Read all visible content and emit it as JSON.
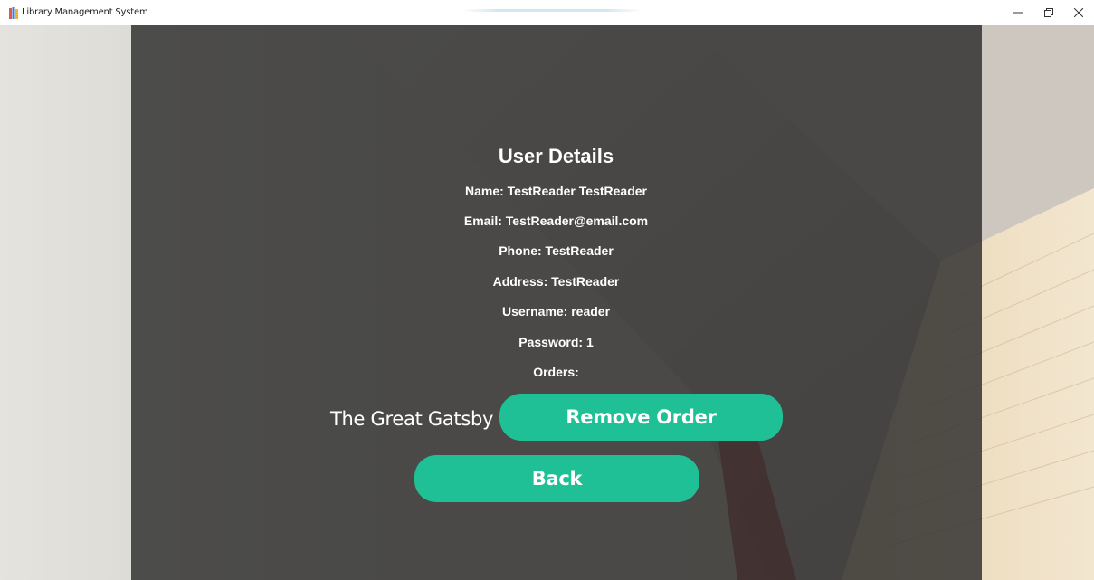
{
  "window": {
    "title": "Library Management System"
  },
  "colors": {
    "accent": "#1fc095",
    "panel": "#2c2c2c",
    "text": "#ffffff"
  },
  "details": {
    "heading": "User Details",
    "name": "Name: TestReader TestReader",
    "email": "Email: TestReader@email.com",
    "phone": "Phone: TestReader",
    "address": "Address: TestReader",
    "username": "Username: reader",
    "password": "Password: 1",
    "orders_label": "Orders:"
  },
  "orders": [
    {
      "title": "The Great Gatsby",
      "remove_label": "Remove Order"
    }
  ],
  "actions": {
    "back_label": "Back"
  }
}
